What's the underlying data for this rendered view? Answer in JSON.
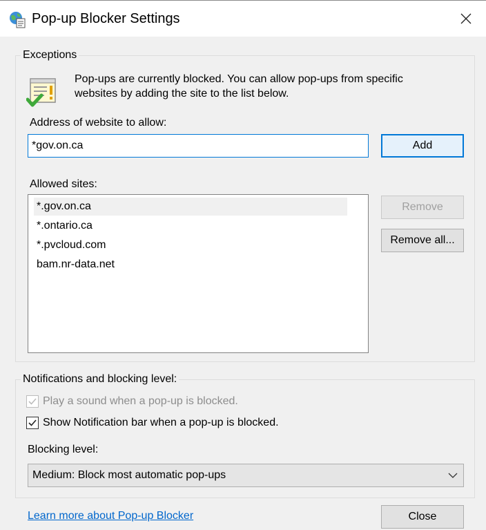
{
  "window": {
    "title": "Pop-up Blocker Settings",
    "icon": "globe-settings-icon",
    "close_icon": "close-icon"
  },
  "exceptions": {
    "group_label": "Exceptions",
    "info_icon": "document-checkmark-icon",
    "info_line1": "Pop-ups are currently blocked.  You can allow pop-ups from specific",
    "info_line2": "websites by adding the site to the list below.",
    "address_label": "Address of website to allow:",
    "address_value": "*gov.on.ca",
    "add_button": "Add",
    "allowed_label": "Allowed sites:",
    "allowed_sites": [
      "*.gov.on.ca",
      "*.ontario.ca",
      "*.pvcloud.com",
      "bam.nr-data.net"
    ],
    "remove_button": "Remove",
    "remove_all_button": "Remove all..."
  },
  "notifications": {
    "group_label": "Notifications and blocking level:",
    "play_sound_label": "Play a sound when a pop-up is blocked.",
    "play_sound_checked": true,
    "play_sound_enabled": false,
    "show_bar_label": "Show Notification bar when a pop-up is blocked.",
    "show_bar_checked": true,
    "blocking_level_label": "Blocking level:",
    "blocking_level_value": "Medium: Block most automatic pop-ups"
  },
  "footer": {
    "learn_more_link": "Learn more about Pop-up Blocker",
    "close_button": "Close"
  },
  "colors": {
    "accent": "#0078d7",
    "link": "#0066cc",
    "check_green": "#3fa93a"
  }
}
